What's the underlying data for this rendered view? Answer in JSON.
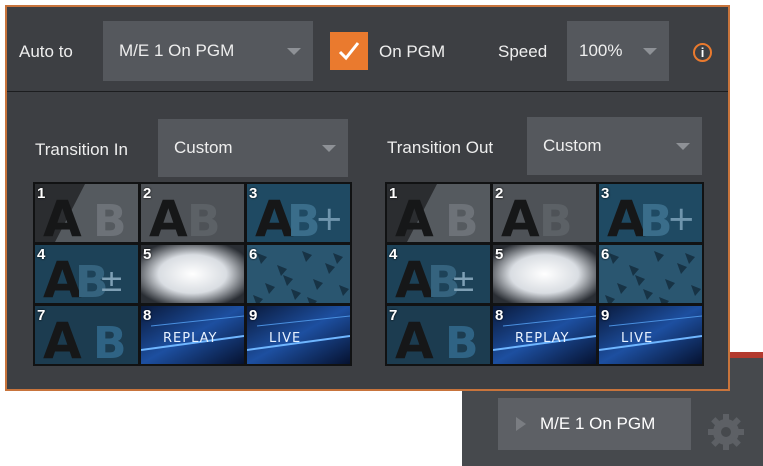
{
  "toolbar": {
    "auto_to_label": "Auto to",
    "auto_to_value": "M/E 1 On PGM",
    "on_pgm_checked": true,
    "on_pgm_label": "On PGM",
    "speed_label": "Speed",
    "speed_value": "100%",
    "info_icon": "i"
  },
  "transition_in": {
    "label": "Transition In",
    "value": "Custom",
    "tiles": [
      {
        "num": "1",
        "icon": "ab-wipe-diagonal"
      },
      {
        "num": "2",
        "icon": "ab-dissolve"
      },
      {
        "num": "3",
        "icon": "ab-add"
      },
      {
        "num": "4",
        "icon": "ab-plus-minus"
      },
      {
        "num": "5",
        "icon": "soft-glow"
      },
      {
        "num": "6",
        "icon": "texture-pattern"
      },
      {
        "num": "7",
        "icon": "ab-push"
      },
      {
        "num": "8",
        "icon": "replay-stinger",
        "text": "REPLAY",
        "selected": true
      },
      {
        "num": "9",
        "icon": "live-stinger",
        "text": "LIVE"
      }
    ]
  },
  "transition_out": {
    "label": "Transition Out",
    "value": "Custom",
    "tiles": [
      {
        "num": "1",
        "icon": "ab-wipe-diagonal"
      },
      {
        "num": "2",
        "icon": "ab-dissolve"
      },
      {
        "num": "3",
        "icon": "ab-add"
      },
      {
        "num": "4",
        "icon": "ab-plus-minus"
      },
      {
        "num": "5",
        "icon": "soft-glow"
      },
      {
        "num": "6",
        "icon": "texture-pattern"
      },
      {
        "num": "7",
        "icon": "ab-push"
      },
      {
        "num": "8",
        "icon": "replay-stinger",
        "text": "REPLAY"
      },
      {
        "num": "9",
        "icon": "live-stinger",
        "text": "LIVE",
        "selected": true
      }
    ]
  },
  "footer": {
    "pgm_button_label": "M/E 1 On PGM",
    "gear_icon": "gear-icon"
  },
  "colors": {
    "accent": "#ea7a2e",
    "panel": "#3d3f43",
    "red": "#b33a2e"
  }
}
